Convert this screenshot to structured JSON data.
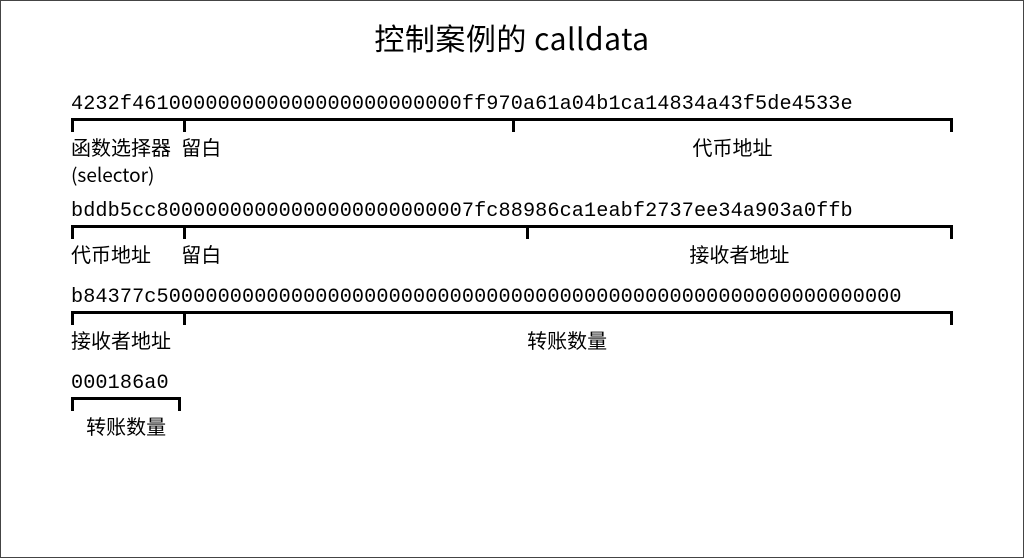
{
  "title": "控制案例的 calldata",
  "rows": [
    {
      "segments": [
        {
          "hex": "4232f461",
          "label": "函数选择器",
          "sublabel": "(selector)",
          "label_align": "left"
        },
        {
          "hex": "000000000000000000000000",
          "label": "留白",
          "label_align": "center"
        },
        {
          "hex": "ff970a61a04b1ca14834a43f5de4533e",
          "label": "代币地址",
          "label_align": "center"
        }
      ]
    },
    {
      "segments": [
        {
          "hex": "bddb5cc8",
          "label": "代币地址",
          "label_align": "left"
        },
        {
          "hex": "0000000000000000000000007",
          "label": "留白",
          "label_align": "center"
        },
        {
          "hex": "fc88986ca1eabf2737ee34a903a0ffb",
          "label": "接收者地址",
          "label_align": "center"
        }
      ]
    },
    {
      "segments": [
        {
          "hex": "b84377c5",
          "label": "接收者地址",
          "label_align": "left"
        },
        {
          "hex": "000000000000000000000000000000000000000000000000000000000000",
          "label": "转账数量",
          "label_align": "center"
        }
      ]
    },
    {
      "segments": [
        {
          "hex": "000186a0",
          "label": "转账数量",
          "label_align": "center"
        }
      ]
    }
  ]
}
